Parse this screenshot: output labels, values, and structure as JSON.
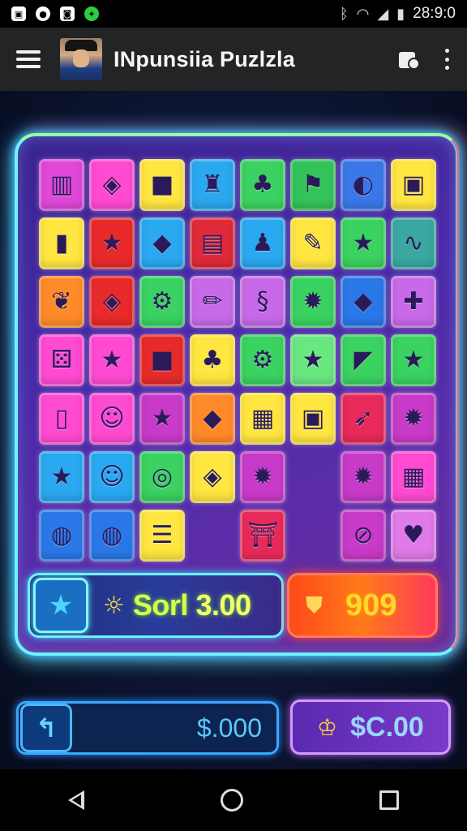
{
  "status_bar": {
    "time": "28:9:0",
    "icons": [
      "screenshot-icon",
      "circle-app-icon",
      "photo-icon",
      "game-controller-icon",
      "bluetooth-icon",
      "wifi-icon",
      "signal-icon",
      "battery-icon"
    ]
  },
  "app_bar": {
    "title": "INpunsiia Puzlzla",
    "icons": [
      "menu-icon",
      "avatar",
      "store-icon",
      "overflow-menu-icon"
    ]
  },
  "board": {
    "columns": 8,
    "rows": 7,
    "tiles": [
      {
        "r": 0,
        "c": 0,
        "color": "#e048d8",
        "icon": "film-strip-icon",
        "glyph": "▥"
      },
      {
        "r": 0,
        "c": 1,
        "color": "#ff4ad2",
        "icon": "map-shape-icon",
        "glyph": "◈"
      },
      {
        "r": 0,
        "c": 2,
        "color": "#ffe640",
        "icon": "red-square-icon",
        "glyph": "■"
      },
      {
        "r": 0,
        "c": 3,
        "color": "#2aa8f0",
        "icon": "robot-icon",
        "glyph": "♜"
      },
      {
        "r": 0,
        "c": 4,
        "color": "#3ad260",
        "icon": "cherry-icon",
        "glyph": "♣"
      },
      {
        "r": 0,
        "c": 5,
        "color": "#34c35a",
        "icon": "red-flag-icon",
        "glyph": "⚑"
      },
      {
        "r": 0,
        "c": 6,
        "color": "#3a78e8",
        "icon": "half-circle-icon",
        "glyph": "◐"
      },
      {
        "r": 0,
        "c": 7,
        "color": "#ffe640",
        "icon": "box-icon",
        "glyph": "▣"
      },
      {
        "r": 1,
        "c": 0,
        "color": "#ffe640",
        "icon": "green-rectangle-icon",
        "glyph": "▮"
      },
      {
        "r": 1,
        "c": 1,
        "color": "#e82a2a",
        "icon": "star-icon",
        "glyph": "★"
      },
      {
        "r": 1,
        "c": 2,
        "color": "#2aa8f0",
        "icon": "blob-icon",
        "glyph": "◆"
      },
      {
        "r": 1,
        "c": 3,
        "color": "#e02a3a",
        "icon": "bag-icon",
        "glyph": "▤"
      },
      {
        "r": 1,
        "c": 4,
        "color": "#2aa8f0",
        "icon": "shirt-icon",
        "glyph": "♟"
      },
      {
        "r": 1,
        "c": 5,
        "color": "#ffe640",
        "icon": "pencil-icon",
        "glyph": "✎"
      },
      {
        "r": 1,
        "c": 6,
        "color": "#3ad260",
        "icon": "star-icon",
        "glyph": "★"
      },
      {
        "r": 1,
        "c": 7,
        "color": "#3aa8a0",
        "icon": "snake-icon",
        "glyph": "∿"
      },
      {
        "r": 2,
        "c": 0,
        "color": "#ff8a2a",
        "icon": "leaf-icon",
        "glyph": "❦"
      },
      {
        "r": 2,
        "c": 1,
        "color": "#e82a2a",
        "icon": "map-shape-icon",
        "glyph": "◈"
      },
      {
        "r": 2,
        "c": 2,
        "color": "#3ad260",
        "icon": "gear-chain-icon",
        "glyph": "⚙"
      },
      {
        "r": 2,
        "c": 3,
        "color": "#c86ae8",
        "icon": "pencil-icon",
        "glyph": "✏"
      },
      {
        "r": 2,
        "c": 4,
        "color": "#c86ae8",
        "icon": "squiggle-icon",
        "glyph": "§"
      },
      {
        "r": 2,
        "c": 5,
        "color": "#3ad260",
        "icon": "splat-icon",
        "glyph": "✹"
      },
      {
        "r": 2,
        "c": 6,
        "color": "#2a78e8",
        "icon": "blob-icon",
        "glyph": "◆"
      },
      {
        "r": 2,
        "c": 7,
        "color": "#c86ae8",
        "icon": "cross-blob-icon",
        "glyph": "✚"
      },
      {
        "r": 3,
        "c": 0,
        "color": "#ff4ad2",
        "icon": "dice-icon",
        "glyph": "⚄"
      },
      {
        "r": 3,
        "c": 1,
        "color": "#ff4ad2",
        "icon": "star-icon",
        "glyph": "★"
      },
      {
        "r": 3,
        "c": 2,
        "color": "#e82a2a",
        "icon": "blue-square-icon",
        "glyph": "■"
      },
      {
        "r": 3,
        "c": 3,
        "color": "#ffe640",
        "icon": "cherry-icon",
        "glyph": "♣"
      },
      {
        "r": 3,
        "c": 4,
        "color": "#3ad260",
        "icon": "gear-chain-icon",
        "glyph": "⚙"
      },
      {
        "r": 3,
        "c": 5,
        "color": "#6ae880",
        "icon": "star-icon",
        "glyph": "★"
      },
      {
        "r": 3,
        "c": 6,
        "color": "#3ad260",
        "icon": "pennant-icon",
        "glyph": "◤"
      },
      {
        "r": 3,
        "c": 7,
        "color": "#3ad260",
        "icon": "star-icon",
        "glyph": "★"
      },
      {
        "r": 4,
        "c": 0,
        "color": "#ff4ad2",
        "icon": "bottle-icon",
        "glyph": "▯"
      },
      {
        "r": 4,
        "c": 1,
        "color": "#ff4ad2",
        "icon": "cat-face-icon",
        "glyph": "☺"
      },
      {
        "r": 4,
        "c": 2,
        "color": "#c83ac8",
        "icon": "star-icon",
        "glyph": "★"
      },
      {
        "r": 4,
        "c": 3,
        "color": "#ff8a2a",
        "icon": "blob-icon",
        "glyph": "◆"
      },
      {
        "r": 4,
        "c": 4,
        "color": "#ffe640",
        "icon": "calculator-icon",
        "glyph": "▦"
      },
      {
        "r": 4,
        "c": 5,
        "color": "#ffe640",
        "icon": "box-icon",
        "glyph": "▣"
      },
      {
        "r": 4,
        "c": 6,
        "color": "#e82a5a",
        "icon": "carrot-icon",
        "glyph": "➶"
      },
      {
        "r": 4,
        "c": 7,
        "color": "#c83ac8",
        "icon": "splat-icon",
        "glyph": "✹"
      },
      {
        "r": 5,
        "c": 0,
        "color": "#2aa8f0",
        "icon": "star-icon",
        "glyph": "★"
      },
      {
        "r": 5,
        "c": 1,
        "color": "#2aa8f0",
        "icon": "cat-face-icon",
        "glyph": "☺"
      },
      {
        "r": 5,
        "c": 2,
        "color": "#3ad260",
        "icon": "ring-icon",
        "glyph": "◎"
      },
      {
        "r": 5,
        "c": 3,
        "color": "#ffe640",
        "icon": "map-shape-icon",
        "glyph": "◈"
      },
      {
        "r": 5,
        "c": 4,
        "color": "#c83ac8",
        "icon": "splat-icon",
        "glyph": "✹"
      },
      {
        "r": 5,
        "c": 6,
        "color": "#c83ac8",
        "icon": "splat-icon",
        "glyph": "✹"
      },
      {
        "r": 5,
        "c": 7,
        "color": "#ff4ad2",
        "icon": "calculator-icon",
        "glyph": "▦"
      },
      {
        "r": 6,
        "c": 0,
        "color": "#2a78e8",
        "icon": "ball-icon",
        "glyph": "◍"
      },
      {
        "r": 6,
        "c": 1,
        "color": "#2a78e8",
        "icon": "ball-icon",
        "glyph": "◍"
      },
      {
        "r": 6,
        "c": 2,
        "color": "#ffe640",
        "icon": "stripes-icon",
        "glyph": "☰"
      },
      {
        "r": 6,
        "c": 4,
        "color": "#e82a5a",
        "icon": "gift-icon",
        "glyph": "⛩"
      },
      {
        "r": 6,
        "c": 6,
        "color": "#c83ac8",
        "icon": "no-sign-icon",
        "glyph": "⊘"
      },
      {
        "r": 6,
        "c": 7,
        "color": "#e07ae8",
        "icon": "heart-icon",
        "glyph": "♥"
      }
    ]
  },
  "score_panel": {
    "star_button_icon": "star-icon",
    "sun_icon": "sun-icon",
    "label": "Sorl",
    "value": "3.00"
  },
  "coins_panel": {
    "icon": "shield-icon",
    "value": "909"
  },
  "bottom_controls": {
    "back_icon": "undo-arrow-icon",
    "back_amount": "$.000",
    "coin_button_icon": "crown-icon",
    "coin_button_value": "$C.00"
  },
  "nav_bar": {
    "icons": [
      "nav-back-icon",
      "nav-home-icon",
      "nav-recents-icon"
    ]
  },
  "colors": {
    "frame_glow": "#6ff2ff",
    "score_text": "#d9ff4a",
    "coins_text": "#ffd830",
    "accent_purple": "#b56aff"
  }
}
